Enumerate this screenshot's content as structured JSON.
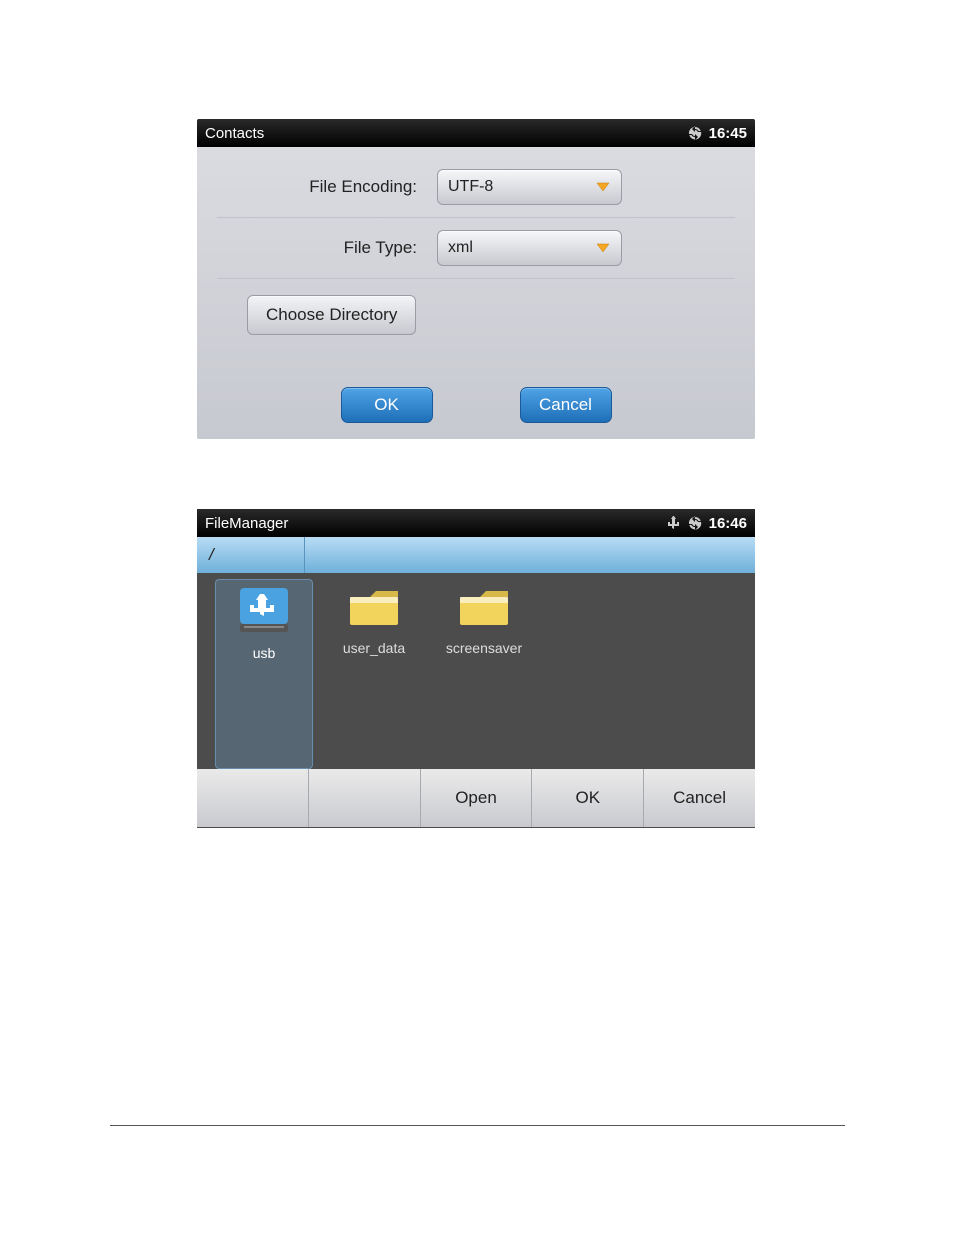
{
  "screen1": {
    "title": "Contacts",
    "time": "16:45",
    "fields": {
      "encoding_label": "File Encoding:",
      "encoding_value": "UTF-8",
      "type_label": "File Type:",
      "type_value": "xml",
      "choose_dir": "Choose Directory"
    },
    "buttons": {
      "ok": "OK",
      "cancel": "Cancel"
    }
  },
  "screen2": {
    "title": "FileManager",
    "time": "16:46",
    "path": "/",
    "items": [
      "usb",
      "user_data",
      "screensaver"
    ],
    "buttons": {
      "open": "Open",
      "ok": "OK",
      "cancel": "Cancel"
    }
  }
}
